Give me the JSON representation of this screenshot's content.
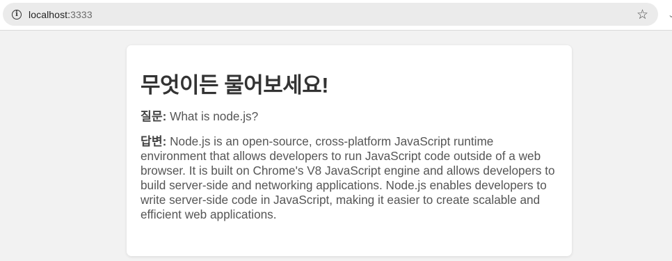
{
  "browser": {
    "url_host": "localhost:",
    "url_port": "3333",
    "info_icon_glyph": "i",
    "star_glyph": "☆",
    "edge_glyph": "⌄"
  },
  "page": {
    "title": "무엇이든 물어보세요!",
    "question_label": "질문:",
    "question_text": " What is node.js?",
    "answer_label": "답변:",
    "answer_text": " Node.js is an open-source, cross-platform JavaScript runtime environment that allows developers to run JavaScript code outside of a web browser. It is built on Chrome's V8 JavaScript engine and allows developers to build server-side and networking applications. Node.js enables developers to write server-side code in JavaScript, making it easier to create scalable and efficient web applications."
  },
  "icons": {
    "info": "info-icon",
    "star": "star-icon"
  }
}
